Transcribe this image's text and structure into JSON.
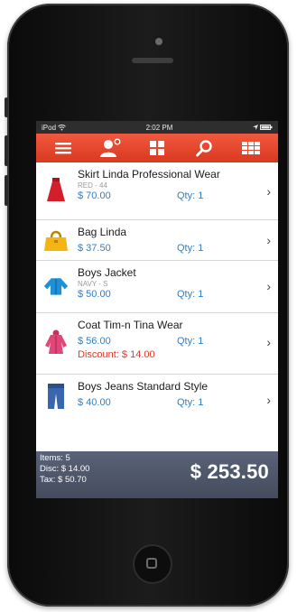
{
  "status_bar": {
    "carrier": "iPod",
    "time": "2:02 PM"
  },
  "nav": {
    "icons": [
      "menu-icon",
      "customer-add-icon",
      "categories-grid-icon",
      "search-icon",
      "keypad-grid-icon"
    ]
  },
  "items": [
    {
      "name": "Skirt Linda Professional Wear",
      "variant": "RED - 44",
      "price": "$ 70.00",
      "qty": "Qty: 1",
      "icon": "skirt-icon"
    },
    {
      "name": "Bag Linda",
      "price": "$ 37.50",
      "qty": "Qty: 1",
      "icon": "bag-icon"
    },
    {
      "name": "Boys Jacket",
      "variant": "NAVY - S",
      "price": "$ 50.00",
      "qty": "Qty: 1",
      "icon": "jacket-icon"
    },
    {
      "name": "Coat Tim-n Tina Wear",
      "price": "$ 56.00",
      "qty": "Qty: 1",
      "discount": "Discount: $ 14.00",
      "icon": "coat-icon"
    },
    {
      "name": "Boys Jeans Standard Style",
      "price": "$ 40.00",
      "qty": "Qty: 1",
      "icon": "jeans-icon"
    }
  ],
  "footer": {
    "items": "Items: 5",
    "disc": "Disc: $ 14.00",
    "tax": "Tax: $ 50.70",
    "total": "$ 253.50"
  },
  "colors": {
    "nav_red": "#e2452b",
    "price_blue": "#2f7fc8",
    "discount_red": "#e0392a",
    "footer_slate": "#4f586b"
  }
}
